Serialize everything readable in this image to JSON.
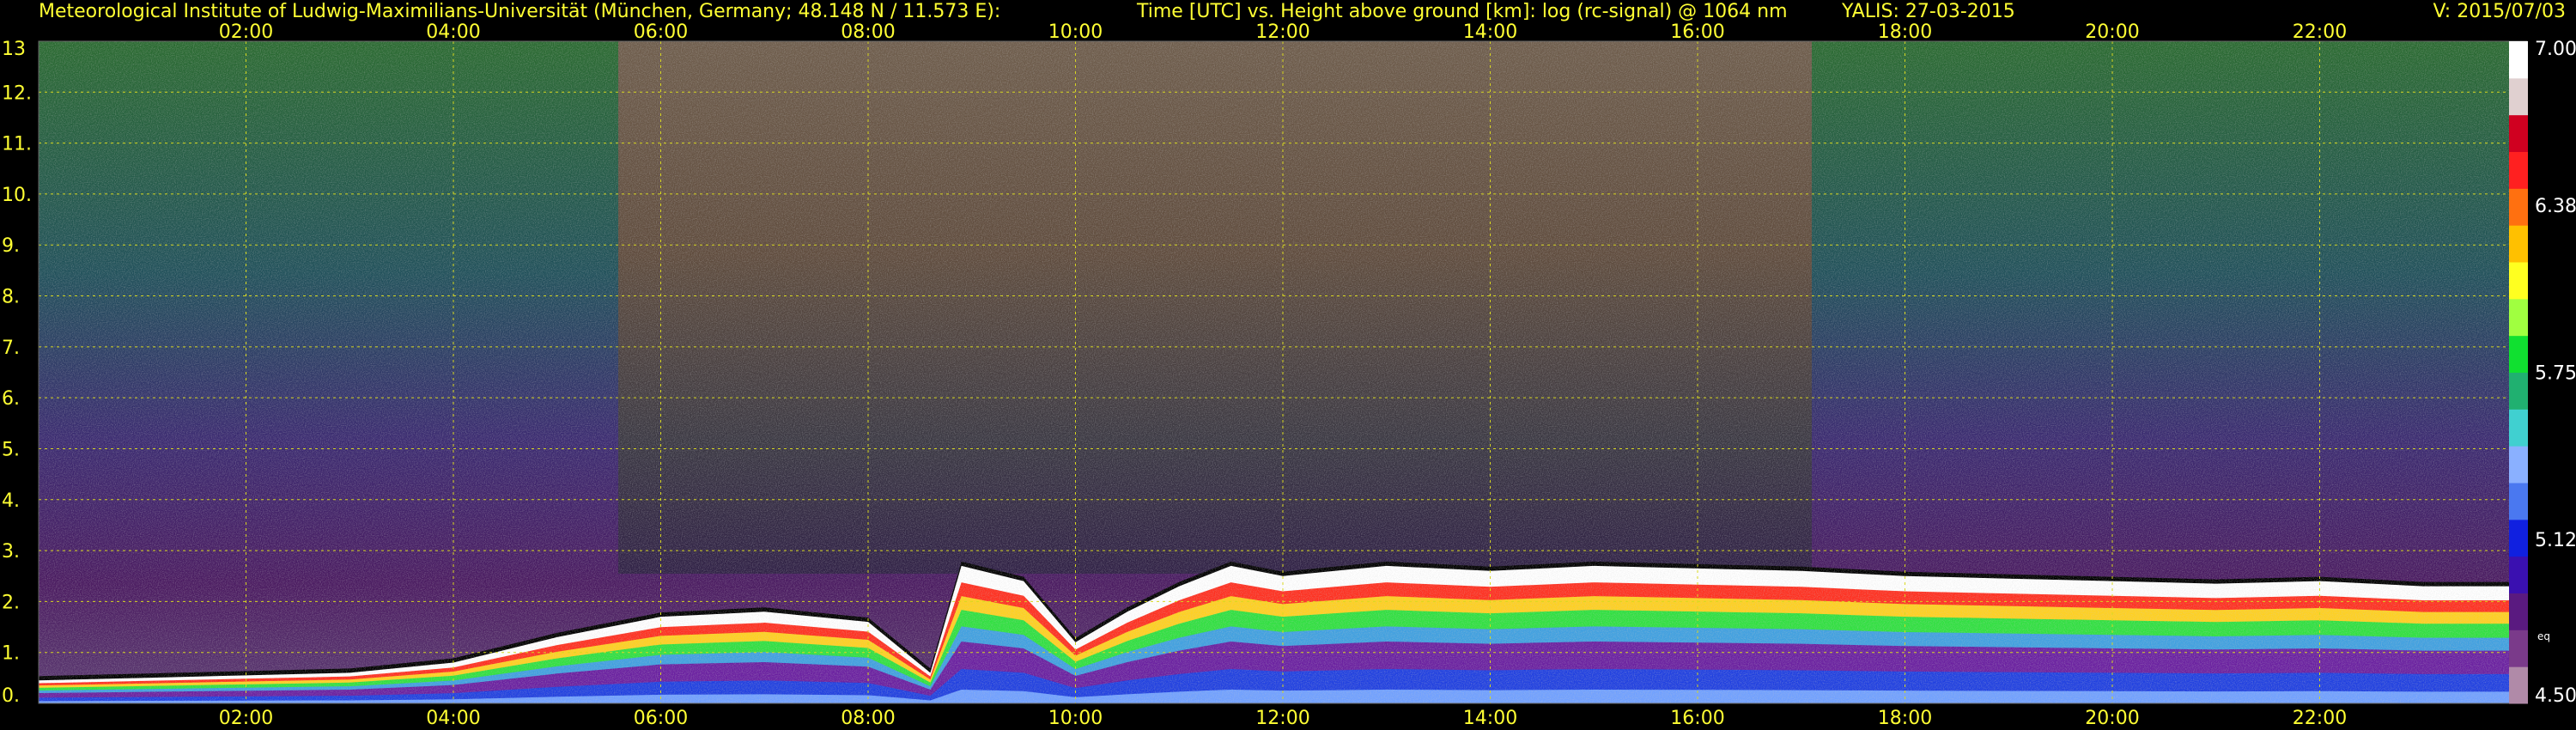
{
  "header": {
    "institute": "Meteorological Institute of Ludwig-Maximilians-Universität (München, Germany; 48.148 N / 11.573 E):",
    "plot_title": "Time [UTC] vs. Height above ground [km]: log (rc-signal) @ 1064 nm",
    "instrument_date": "YALIS: 27-03-2015",
    "version": "V: 2015/07/03"
  },
  "chart_data": {
    "type": "heatmap",
    "title": "Time [UTC] vs. Height above ground [km]: log (rc-signal) @ 1064 nm",
    "x_ticks": [
      "02:00",
      "04:00",
      "06:00",
      "08:00",
      "10:00",
      "12:00",
      "14:00",
      "16:00",
      "18:00",
      "20:00",
      "22:00"
    ],
    "x_tick_hours": [
      2,
      4,
      6,
      8,
      10,
      12,
      14,
      16,
      18,
      20,
      22
    ],
    "xlim_hours": [
      0,
      24
    ],
    "y_ticks": [
      "13",
      "12.",
      "11.",
      "10.",
      "9.",
      "8.",
      "7.",
      "6.",
      "5.",
      "4.",
      "3.",
      "2.",
      "1.",
      "0."
    ],
    "y_tick_values": [
      13,
      12,
      11,
      10,
      9,
      8,
      7,
      6,
      5,
      4,
      3,
      2,
      1,
      0
    ],
    "ylim_km": [
      0,
      13
    ],
    "grid": true,
    "colorbar": {
      "ticks": [
        "7.00",
        "6.38",
        "5.75",
        "5.12",
        "4.50"
      ],
      "tick_values": [
        7.0,
        6.38,
        5.75,
        5.12,
        4.5
      ],
      "range": [
        4.5,
        7.0
      ],
      "note": "eq",
      "colors": [
        "#b08aa8",
        "#7a3a8a",
        "#5a1a80",
        "#3a10b0",
        "#1020e0",
        "#4a78f0",
        "#8ab0ff",
        "#40d0d0",
        "#20b070",
        "#10e030",
        "#a0ff40",
        "#ffff20",
        "#ffc000",
        "#ff7010",
        "#ff2020",
        "#d00020",
        "#e0d0d0",
        "#ffffff"
      ]
    },
    "boundary_layer_top_km": [
      [
        0.0,
        0.45
      ],
      [
        1.0,
        0.5
      ],
      [
        2.0,
        0.55
      ],
      [
        3.0,
        0.6
      ],
      [
        4.0,
        0.8
      ],
      [
        5.0,
        1.3
      ],
      [
        6.0,
        1.7
      ],
      [
        6.5,
        1.75
      ],
      [
        7.0,
        1.8
      ],
      [
        8.0,
        1.6
      ],
      [
        8.6,
        0.6
      ],
      [
        8.9,
        2.7
      ],
      [
        9.5,
        2.4
      ],
      [
        10.0,
        1.2
      ],
      [
        10.5,
        1.8
      ],
      [
        11.0,
        2.3
      ],
      [
        11.5,
        2.7
      ],
      [
        12.0,
        2.5
      ],
      [
        12.5,
        2.6
      ],
      [
        13.0,
        2.7
      ],
      [
        14.0,
        2.6
      ],
      [
        15.0,
        2.7
      ],
      [
        16.0,
        2.65
      ],
      [
        17.0,
        2.6
      ],
      [
        18.0,
        2.5
      ],
      [
        19.0,
        2.45
      ],
      [
        20.0,
        2.4
      ],
      [
        21.0,
        2.35
      ],
      [
        22.0,
        2.4
      ],
      [
        23.0,
        2.3
      ],
      [
        24.0,
        2.3
      ]
    ]
  }
}
